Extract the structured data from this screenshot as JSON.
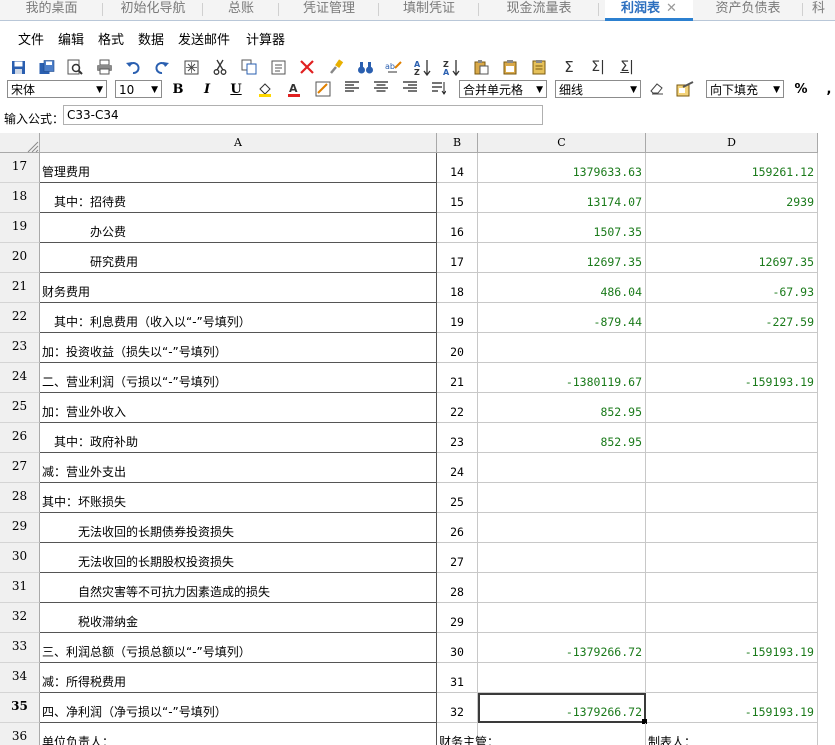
{
  "tabs": [
    {
      "label": "我的桌面",
      "active": false
    },
    {
      "label": "初始化导航",
      "active": false
    },
    {
      "label": "总账",
      "active": false
    },
    {
      "label": "凭证管理",
      "active": false
    },
    {
      "label": "填制凭证",
      "active": false
    },
    {
      "label": "现金流量表",
      "active": false
    },
    {
      "label": "利润表",
      "active": true
    },
    {
      "label": "资产负债表",
      "active": false
    },
    {
      "label": "科",
      "active": false
    }
  ],
  "tab_close": "✕",
  "menu": [
    "文件",
    "编辑",
    "格式",
    "数据",
    "发送邮件",
    "计算器"
  ],
  "toolbar": {
    "font_name": "宋体",
    "font_size": "10",
    "merge": "合并单元格",
    "border": "细线",
    "fill": "向下填充",
    "percent": "%",
    "bold": "B",
    "italic": "I",
    "underline": "U"
  },
  "formula": {
    "label": "输入公式：",
    "value": "C33-C34"
  },
  "columns": [
    "A",
    "B",
    "C",
    "D"
  ],
  "rows": [
    {
      "num": "17",
      "a": "管理费用",
      "indent": 0,
      "b": "14",
      "c": "1379633.63",
      "d": "159261.12"
    },
    {
      "num": "18",
      "a": "其中：招待费",
      "indent": 1,
      "b": "15",
      "c": "13174.07",
      "d": "2939"
    },
    {
      "num": "19",
      "a": "办公费",
      "indent": 3,
      "b": "16",
      "c": "1507.35",
      "d": ""
    },
    {
      "num": "20",
      "a": "研究费用",
      "indent": 3,
      "b": "17",
      "c": "12697.35",
      "d": "12697.35"
    },
    {
      "num": "21",
      "a": "财务费用",
      "indent": 0,
      "b": "18",
      "c": "486.04",
      "d": "-67.93"
    },
    {
      "num": "22",
      "a": "其中：利息费用（收入以“-”号填列）",
      "indent": 1,
      "b": "19",
      "c": "-879.44",
      "d": "-227.59"
    },
    {
      "num": "23",
      "a": "加：投资收益（损失以“-”号填列）",
      "indent": 0,
      "b": "20",
      "c": "",
      "d": ""
    },
    {
      "num": "24",
      "a": "二、营业利润（亏损以“-”号填列）",
      "indent": 0,
      "b": "21",
      "c": "-1380119.67",
      "d": "-159193.19"
    },
    {
      "num": "25",
      "a": "加：营业外收入",
      "indent": 0,
      "b": "22",
      "c": "852.95",
      "d": ""
    },
    {
      "num": "26",
      "a": "其中：政府补助",
      "indent": 1,
      "b": "23",
      "c": "852.95",
      "d": ""
    },
    {
      "num": "27",
      "a": "减：营业外支出",
      "indent": 0,
      "b": "24",
      "c": "",
      "d": ""
    },
    {
      "num": "28",
      "a": "其中：坏账损失",
      "indent": 0,
      "b": "25",
      "c": "",
      "d": ""
    },
    {
      "num": "29",
      "a": "无法收回的长期债券投资损失",
      "indent": 2,
      "b": "26",
      "c": "",
      "d": ""
    },
    {
      "num": "30",
      "a": "无法收回的长期股权投资损失",
      "indent": 2,
      "b": "27",
      "c": "",
      "d": ""
    },
    {
      "num": "31",
      "a": "自然灾害等不可抗力因素造成的损失",
      "indent": 2,
      "b": "28",
      "c": "",
      "d": ""
    },
    {
      "num": "32",
      "a": "税收滞纳金",
      "indent": 2,
      "b": "29",
      "c": "",
      "d": ""
    },
    {
      "num": "33",
      "a": "三、利润总额（亏损总额以“-”号填列）",
      "indent": 0,
      "b": "30",
      "c": "-1379266.72",
      "d": "-159193.19"
    },
    {
      "num": "34",
      "a": "减：所得税费用",
      "indent": 0,
      "b": "31",
      "c": "",
      "d": ""
    },
    {
      "num": "35",
      "a": "四、净利润（净亏损以“-”号填列）",
      "indent": 0,
      "b": "32",
      "c": "-1379266.72",
      "d": "-159193.19"
    },
    {
      "num": "36",
      "a": "单位负责人：",
      "indent": 0,
      "b": "财务主管：",
      "c": "",
      "d": "制表人："
    }
  ],
  "selected_cell": "C35",
  "colors": {
    "value_green": "#1a7a1a",
    "active_tab": "#2c6fbf"
  }
}
